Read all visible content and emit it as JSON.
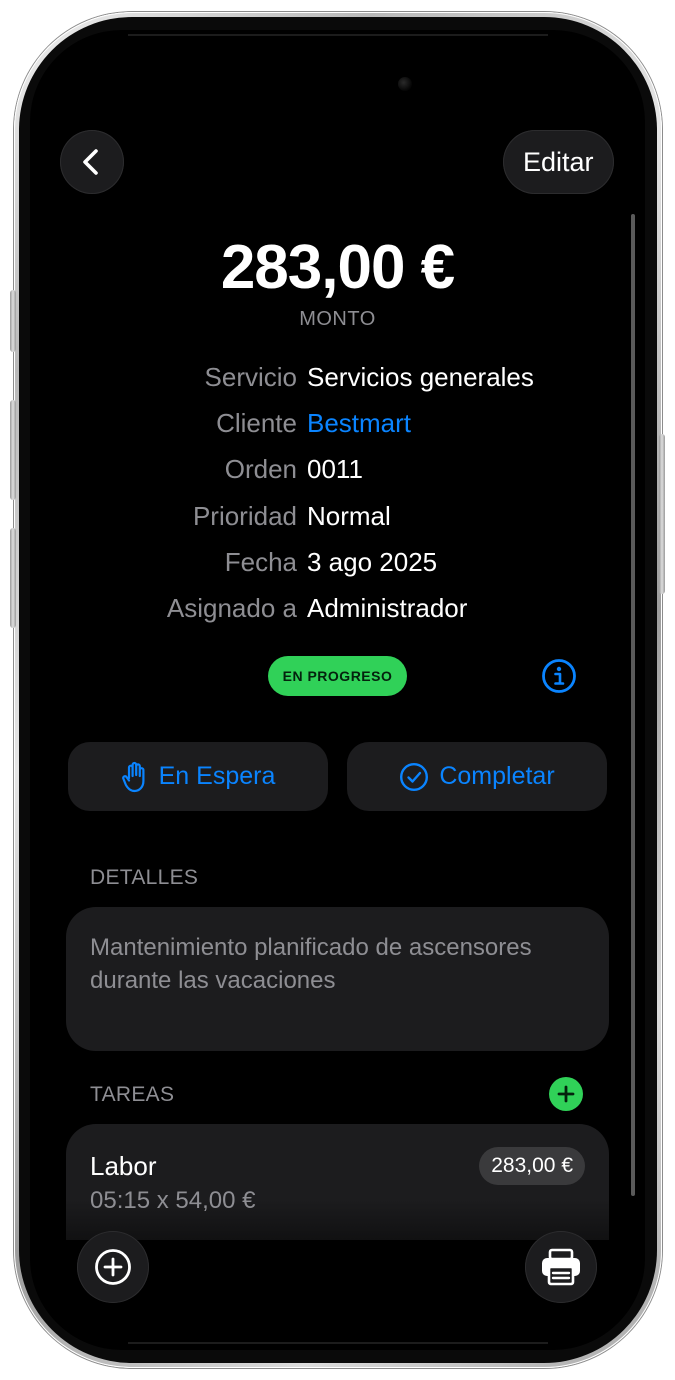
{
  "nav": {
    "edit_label": "Editar"
  },
  "summary": {
    "amount": "283,00 €",
    "amount_label": "MONTO"
  },
  "info": [
    {
      "key": "Servicio",
      "value": "Servicios generales"
    },
    {
      "key": "Cliente",
      "value": "Bestmart"
    },
    {
      "key": "Orden",
      "value": "0011"
    },
    {
      "key": "Prioridad",
      "value": "Normal"
    },
    {
      "key": "Fecha",
      "value": "3 ago 2025"
    },
    {
      "key": "Asignado a",
      "value": "Administrador"
    }
  ],
  "status": {
    "label": "EN PROGRESO",
    "color": "#30d158"
  },
  "actions": {
    "hold_label": "En Espera",
    "complete_label": "Completar"
  },
  "details": {
    "section_label": "DETALLES",
    "text": "Mantenimiento planificado de ascensores durante las vacaciones"
  },
  "tasks": {
    "section_label": "TAREAS",
    "items": [
      {
        "title": "Labor",
        "subtitle": "05:15 x 54,00 €",
        "price": "283,00 €"
      }
    ]
  },
  "colors": {
    "accent": "#0a84ff",
    "success": "#30d158",
    "card": "#1c1c1e"
  },
  "icons": [
    "chevron-left-icon",
    "info-icon",
    "hand-icon",
    "checkmark-circle-icon",
    "plus-icon",
    "plus-circle-icon",
    "printer-icon"
  ]
}
